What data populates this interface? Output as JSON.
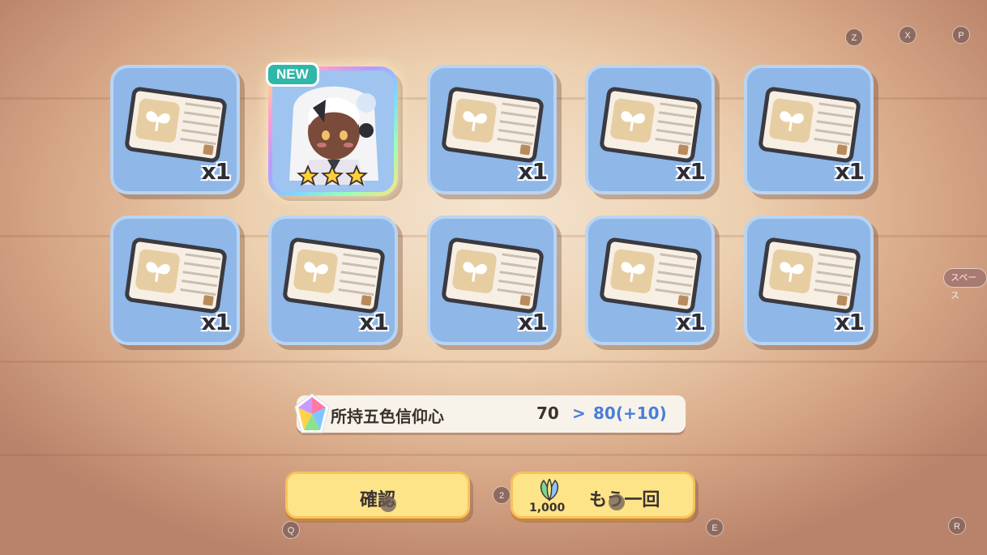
{
  "rewards": [
    {
      "type": "ticket",
      "count": "x1"
    },
    {
      "type": "character",
      "badge": "NEW",
      "stars": 3
    },
    {
      "type": "ticket",
      "count": "x1"
    },
    {
      "type": "ticket",
      "count": "x1"
    },
    {
      "type": "ticket",
      "count": "x1"
    },
    {
      "type": "ticket",
      "count": "x1"
    },
    {
      "type": "ticket",
      "count": "x1"
    },
    {
      "type": "ticket",
      "count": "x1"
    },
    {
      "type": "ticket",
      "count": "x1"
    },
    {
      "type": "ticket",
      "count": "x1"
    }
  ],
  "faith": {
    "label": "所持五色信仰心",
    "current": "70",
    "arrow": ">",
    "next": "80(+10)"
  },
  "buttons": {
    "confirm": "確認",
    "again": "もう一回",
    "again_cost": "1,000"
  },
  "keys": {
    "z": "Z",
    "x": "X",
    "p": "P",
    "space": "スペース",
    "q": "Q",
    "two": "2",
    "e": "E",
    "r": "R"
  },
  "colors": {
    "card_blue": "#8fb7e8",
    "button_yellow": "#fde488",
    "new_badge": "#2fb7a8",
    "faith_value": "#4a7ed8"
  }
}
